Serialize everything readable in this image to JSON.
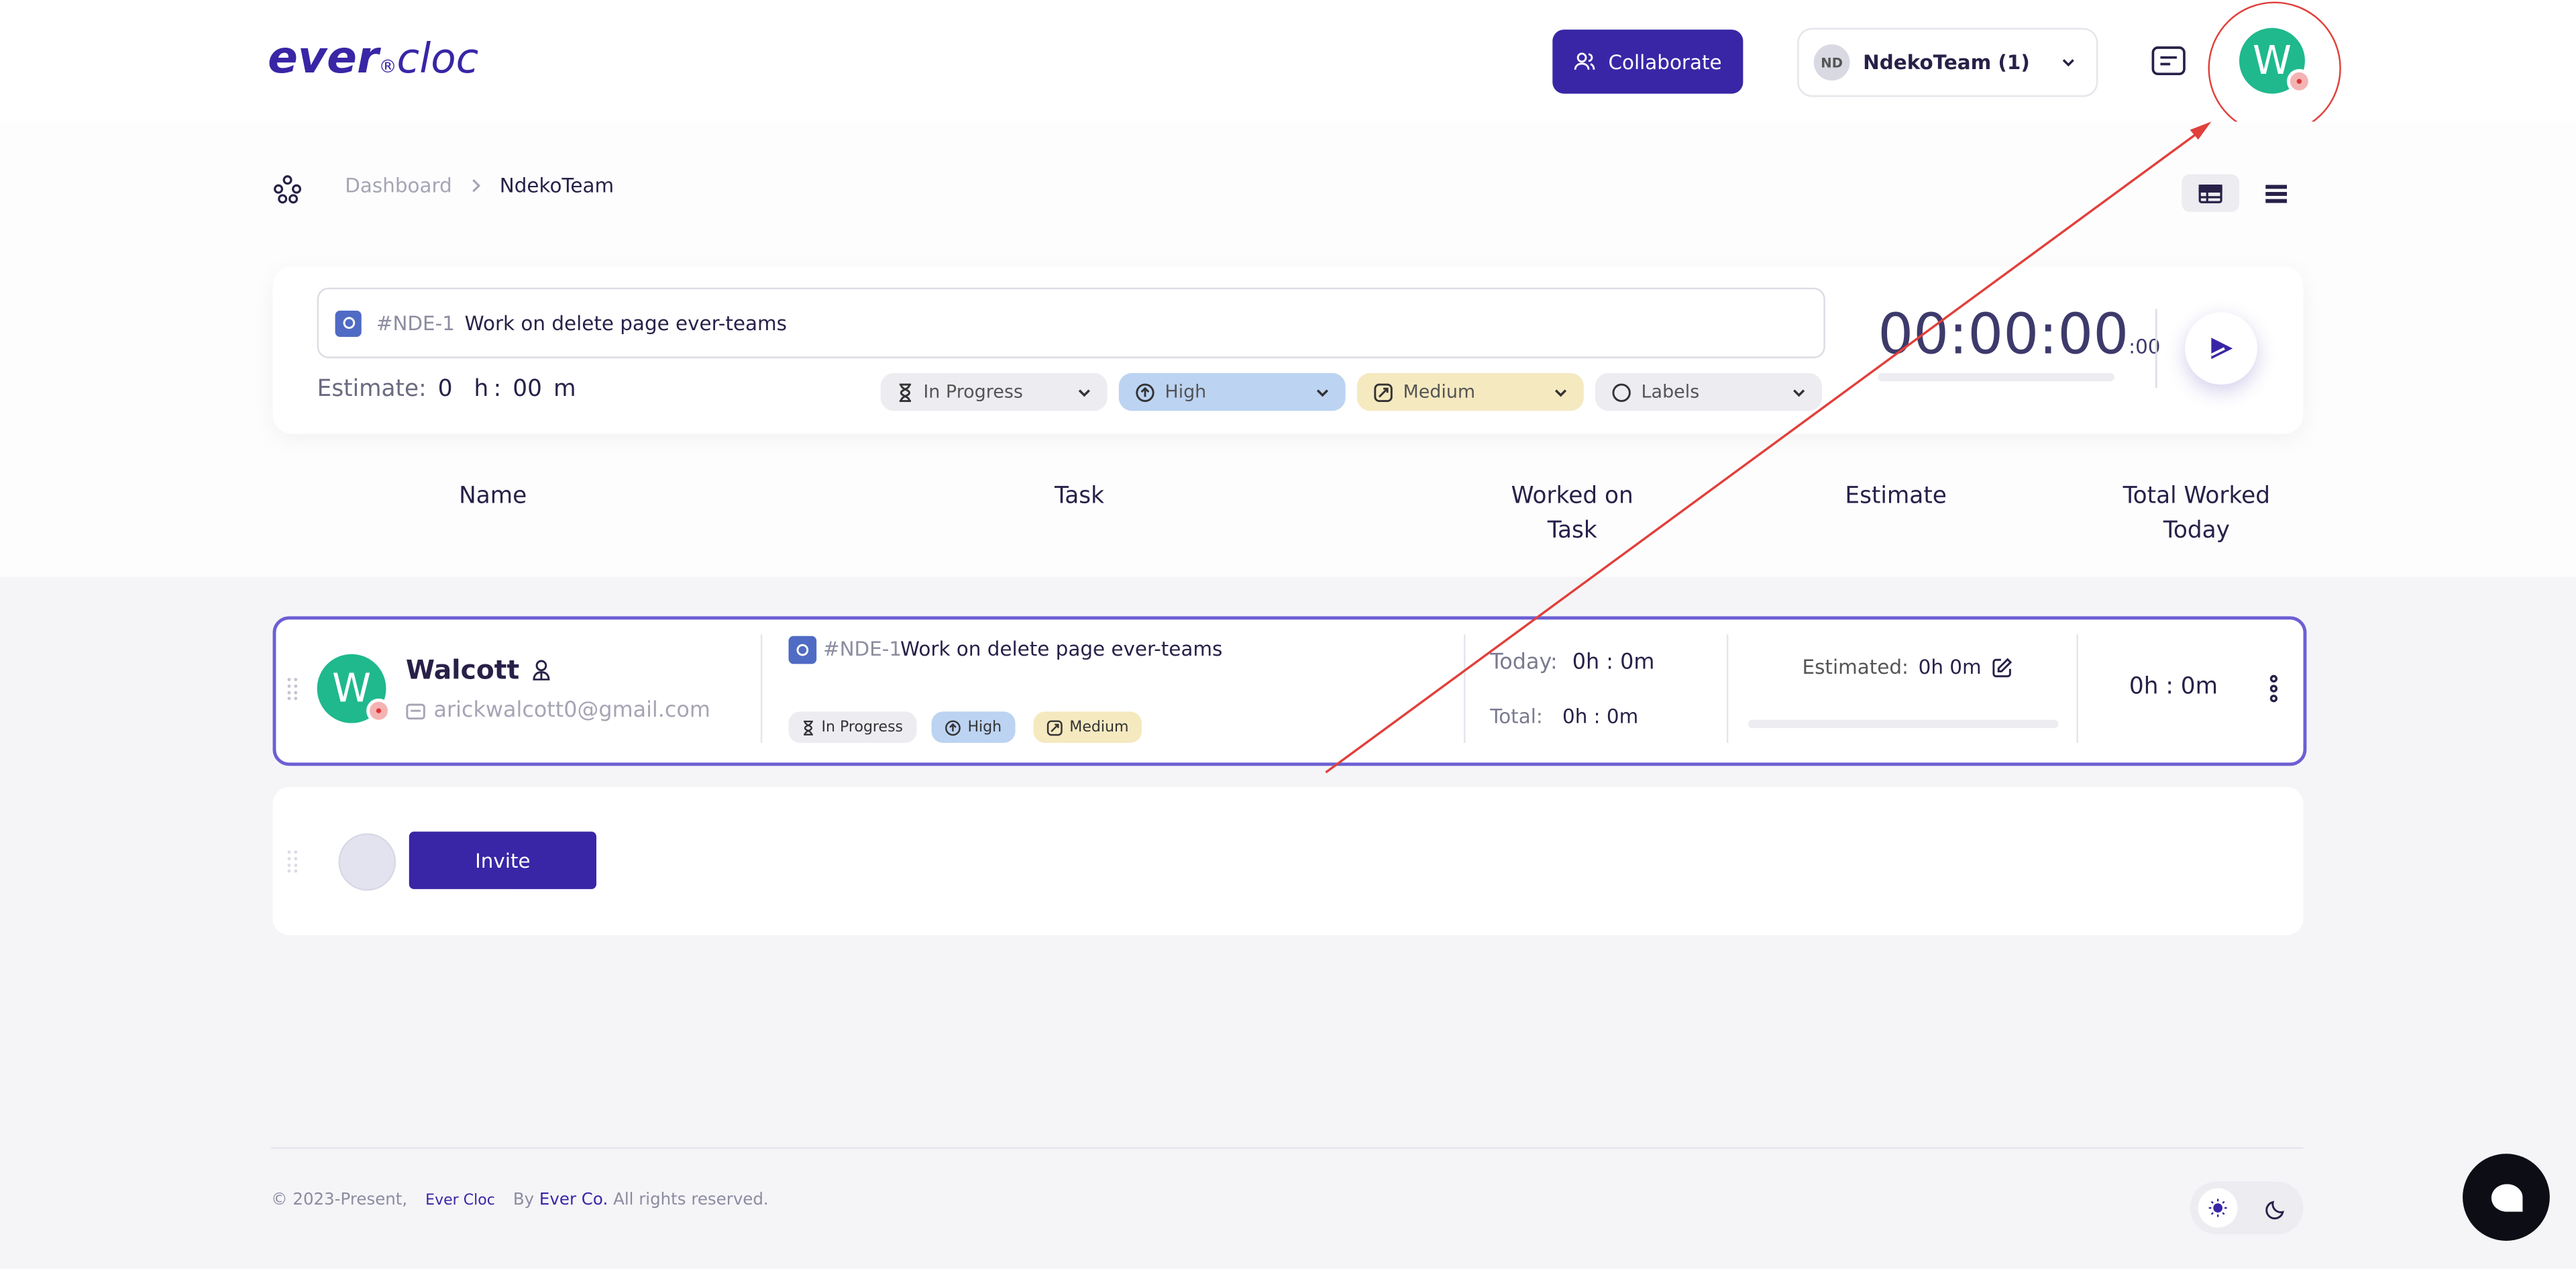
{
  "header": {
    "logo_brand": "ever",
    "logo_reg": "®",
    "logo_product": "cloc",
    "collaborate_label": "Collaborate",
    "team_initials": "ND",
    "team_name": "NdekoTeam (1)",
    "user_initial": "W"
  },
  "breadcrumb": {
    "dashboard": "Dashboard",
    "current": "NdekoTeam"
  },
  "timer": {
    "task_number": "#NDE-1",
    "task_title": "Work on delete page ever-teams",
    "estimate_label": "Estimate:",
    "estimate_hours": "0",
    "estimate_h": "h",
    "estimate_sep": ":",
    "estimate_minutes": "00",
    "estimate_m": "m",
    "status": "In Progress",
    "priority": "High",
    "size": "Medium",
    "labels_placeholder": "Labels",
    "clock": "00:00:00",
    "clock_ms": ":00"
  },
  "columns": {
    "name": "Name",
    "task": "Task",
    "worked_1": "Worked on",
    "worked_2": "Task",
    "estimate": "Estimate",
    "total_1": "Total Worked",
    "total_2": "Today"
  },
  "member": {
    "initial": "W",
    "name": "Walcott",
    "email": "arickwalcott0@gmail.com",
    "task_number": "#NDE-1",
    "task_title": "Work on delete page ever-teams",
    "tag_status": "In Progress",
    "tag_priority": "High",
    "tag_size": "Medium",
    "today_label": "Today:",
    "today_value": "0h : 0m",
    "total_label": "Total:",
    "total_value": "0h : 0m",
    "estimated_label": "Estimated:",
    "estimated_value": "0h 0m",
    "total_today": "0h : 0m"
  },
  "invite": {
    "button": "Invite"
  },
  "footer": {
    "copyright": "© 2023-Present,",
    "brand": "Ever Cloc",
    "by": "By",
    "company": "Ever Co.",
    "rights": "All rights reserved."
  },
  "colors": {
    "primary": "#3826a6",
    "avatar": "#1fb98d",
    "highlight": "#e1403b",
    "priority_bg": "#bcd3f2",
    "size_bg": "#f5e9c0",
    "status_bg": "#ececf1"
  }
}
